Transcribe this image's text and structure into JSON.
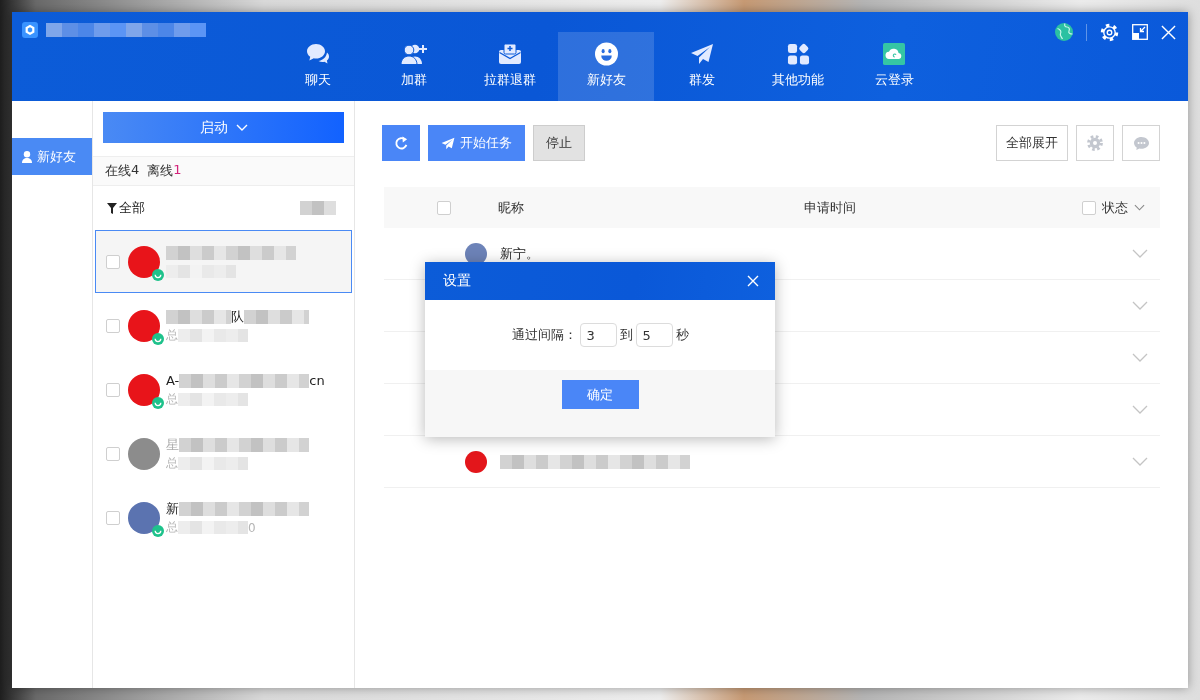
{
  "header": {
    "tabs": [
      {
        "label": "聊天",
        "selected": false
      },
      {
        "label": "加群",
        "selected": false
      },
      {
        "label": "拉群退群",
        "selected": false
      },
      {
        "label": "新好友",
        "selected": true
      },
      {
        "label": "群发",
        "selected": false
      },
      {
        "label": "其他功能",
        "selected": false
      },
      {
        "label": "云登录",
        "selected": false
      }
    ]
  },
  "sidebar": {
    "items": [
      {
        "label": "新好友",
        "selected": true
      }
    ]
  },
  "contacts_panel": {
    "start_button": "启动",
    "counts": [
      {
        "label": "在线",
        "value": "4",
        "color": "#333333"
      },
      {
        "label": "离线",
        "value": "1",
        "color": "#d4237a"
      }
    ],
    "filter": "全部",
    "contacts": [
      {
        "name": [
          {
            "kind": "blur"
          }
        ],
        "detail": [
          {
            "kind": "blur"
          }
        ],
        "color": "#e8141a",
        "online": true,
        "checked": false,
        "selected": true
      },
      {
        "name": [
          {
            "kind": "blur"
          },
          {
            "kind": "text",
            "text": "队"
          },
          {
            "kind": "blur"
          }
        ],
        "detail": [
          {
            "kind": "text",
            "text": "总"
          },
          {
            "kind": "blur"
          }
        ],
        "color": "#e8141a",
        "online": true,
        "checked": false,
        "selected": false
      },
      {
        "name": [
          {
            "kind": "text",
            "text": "A-"
          },
          {
            "kind": "blur"
          },
          {
            "kind": "text",
            "text": "cn"
          }
        ],
        "detail": [
          {
            "kind": "text",
            "text": "总"
          },
          {
            "kind": "blur"
          }
        ],
        "color": "#e8141a",
        "online": true,
        "checked": false,
        "selected": false
      },
      {
        "name": [
          {
            "kind": "text",
            "text": "星"
          },
          {
            "kind": "blur"
          }
        ],
        "detail": [
          {
            "kind": "text",
            "text": "总"
          },
          {
            "kind": "blur"
          }
        ],
        "color": "#8c8c8c",
        "online": false,
        "checked": false,
        "selected": false
      },
      {
        "name": [
          {
            "kind": "text",
            "text": "新"
          },
          {
            "kind": "blur"
          }
        ],
        "detail": [
          {
            "kind": "text",
            "text": "总"
          },
          {
            "kind": "blur"
          },
          {
            "kind": "text",
            "text": "0"
          }
        ],
        "color": "#5b73b0",
        "online": true,
        "checked": false,
        "selected": false
      }
    ]
  },
  "toolbar": {
    "buttons": [
      {
        "label": "开始任务",
        "kind": "primary"
      },
      {
        "label": "停止",
        "kind": "default"
      }
    ],
    "expand_all": "全部展开"
  },
  "table": {
    "columns": [
      "昵称",
      "申请时间",
      "状态"
    ],
    "select_all_checked": false,
    "status_checked": false,
    "rows": [
      {
        "name": [
          {
            "kind": "text",
            "text": "新宁。"
          }
        ],
        "color": "#6d83b8",
        "expanded": false
      },
      {
        "expanded": false
      },
      {
        "expanded": false
      },
      {
        "expanded": false
      },
      {
        "name": [
          {
            "kind": "blur"
          }
        ],
        "color": "#e3161b",
        "expanded": false
      }
    ]
  },
  "dialog": {
    "title": "设置",
    "label": "通过间隔：",
    "from": "3",
    "to_label": "到",
    "to": "5",
    "unit": "秒",
    "confirm": "确定"
  }
}
